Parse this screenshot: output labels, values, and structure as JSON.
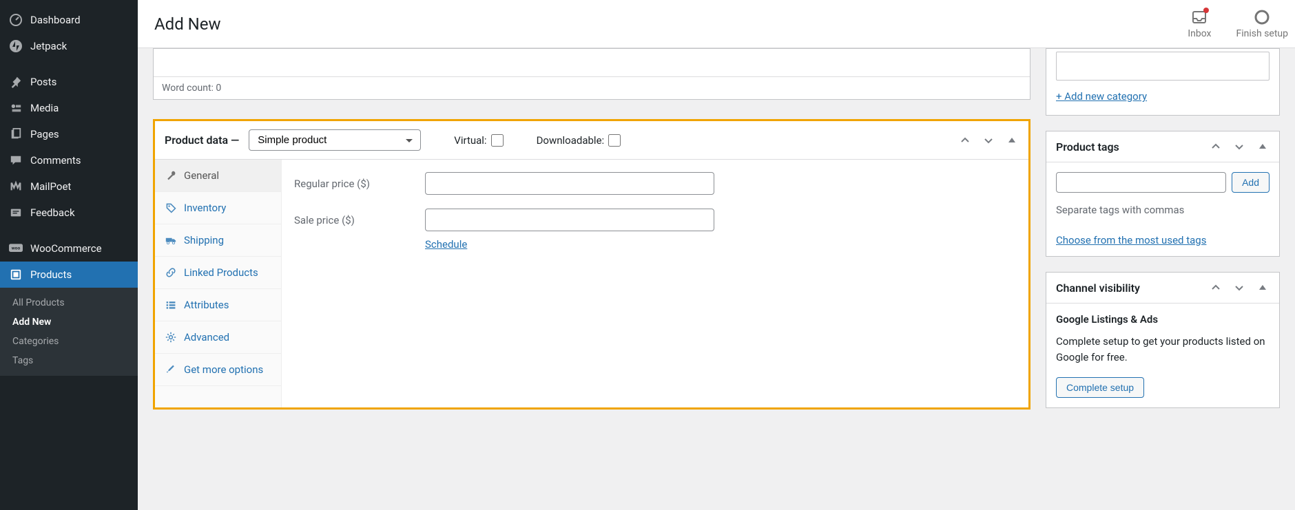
{
  "sidebar": {
    "items": [
      {
        "label": "Dashboard"
      },
      {
        "label": "Jetpack"
      },
      {
        "label": "Posts"
      },
      {
        "label": "Media"
      },
      {
        "label": "Pages"
      },
      {
        "label": "Comments"
      },
      {
        "label": "MailPoet"
      },
      {
        "label": "Feedback"
      },
      {
        "label": "WooCommerce"
      },
      {
        "label": "Products"
      }
    ],
    "sub_products": [
      {
        "label": "All Products"
      },
      {
        "label": "Add New"
      },
      {
        "label": "Categories"
      },
      {
        "label": "Tags"
      }
    ]
  },
  "header": {
    "title": "Add New",
    "actions": {
      "inbox": "Inbox",
      "finish": "Finish setup"
    }
  },
  "editor": {
    "word_count_label": "Word count: 0"
  },
  "product_data": {
    "title": "Product data —",
    "type_selected": "Simple product",
    "virtual_label": "Virtual:",
    "downloadable_label": "Downloadable:",
    "tabs": {
      "general": "General",
      "inventory": "Inventory",
      "shipping": "Shipping",
      "linked": "Linked Products",
      "attributes": "Attributes",
      "advanced": "Advanced",
      "more": "Get more options"
    },
    "fields": {
      "regular_price": "Regular price ($)",
      "sale_price": "Sale price ($)",
      "schedule": "Schedule"
    }
  },
  "categories": {
    "add_new": "+ Add new category"
  },
  "tags": {
    "title": "Product tags",
    "add": "Add",
    "hint": "Separate tags with commas",
    "choose": "Choose from the most used tags"
  },
  "channel": {
    "title": "Channel visibility",
    "google_title": "Google Listings & Ads",
    "google_desc": "Complete setup to get your products listed on Google for free.",
    "complete_btn": "Complete setup"
  }
}
